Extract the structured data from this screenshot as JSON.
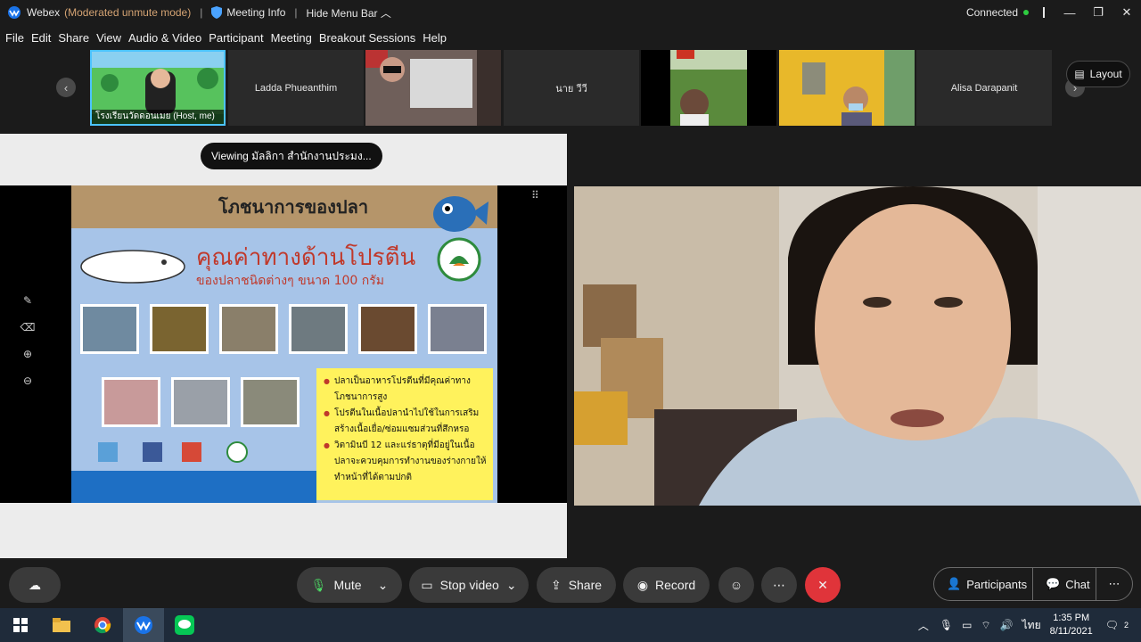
{
  "titlebar": {
    "app_name": "Webex",
    "mode": "(Moderated unmute mode)",
    "meeting_info": "Meeting Info",
    "hide_menu": "Hide Menu Bar",
    "status": "Connected"
  },
  "menu": [
    "File",
    "Edit",
    "Share",
    "View",
    "Audio & Video",
    "Participant",
    "Meeting",
    "Breakout Sessions",
    "Help"
  ],
  "participants": [
    {
      "name": "โรงเรียนวัดดอนเมย (Host, me)",
      "type": "video"
    },
    {
      "name": "Ladda Phueanthim",
      "type": "name"
    },
    {
      "name": "",
      "type": "video"
    },
    {
      "name": "นาย วีวี",
      "type": "name"
    },
    {
      "name": "",
      "type": "video"
    },
    {
      "name": "",
      "type": "video"
    },
    {
      "name": "Alisa Darapanit",
      "type": "name"
    }
  ],
  "layout_label": "Layout",
  "share": {
    "viewing_label": "Viewing มัลลิกา สำนักงานประมง...",
    "slide": {
      "title": "โภชนาการของปลา",
      "subtitle": "คุณค่าทางด้านโปรตีน",
      "subtitle2": "ของปลาชนิดต่างๆ ขนาด 100 กรัม",
      "bullets": [
        "ปลาเป็นอาหารโปรตีนที่มีคุณค่าทางโภชนาการสูง",
        "โปรตีนในเนื้อปลานำไปใช้ในการเสริมสร้างเนื้อเยื่อ/ซ่อมแซมส่วนที่สึกหรอ",
        "วิตามินบี 12 และแร่ธาตุที่มีอยู่ในเนื้อปลาจะควบคุมการทำงานของร่างกายให้ทำหน้าที่ได้ตามปกติ"
      ]
    }
  },
  "controls": {
    "mute": "Mute",
    "stop_video": "Stop video",
    "share": "Share",
    "record": "Record",
    "participants": "Participants",
    "chat": "Chat"
  },
  "taskbar": {
    "time": "1:35 PM",
    "date": "8/11/2021",
    "lang": "ไทย",
    "notif_count": "2"
  },
  "colors": {
    "accent": "#4cc3ff",
    "end_call": "#e0343a",
    "connected": "#2ecc40",
    "mode_text": "#d4a373"
  }
}
